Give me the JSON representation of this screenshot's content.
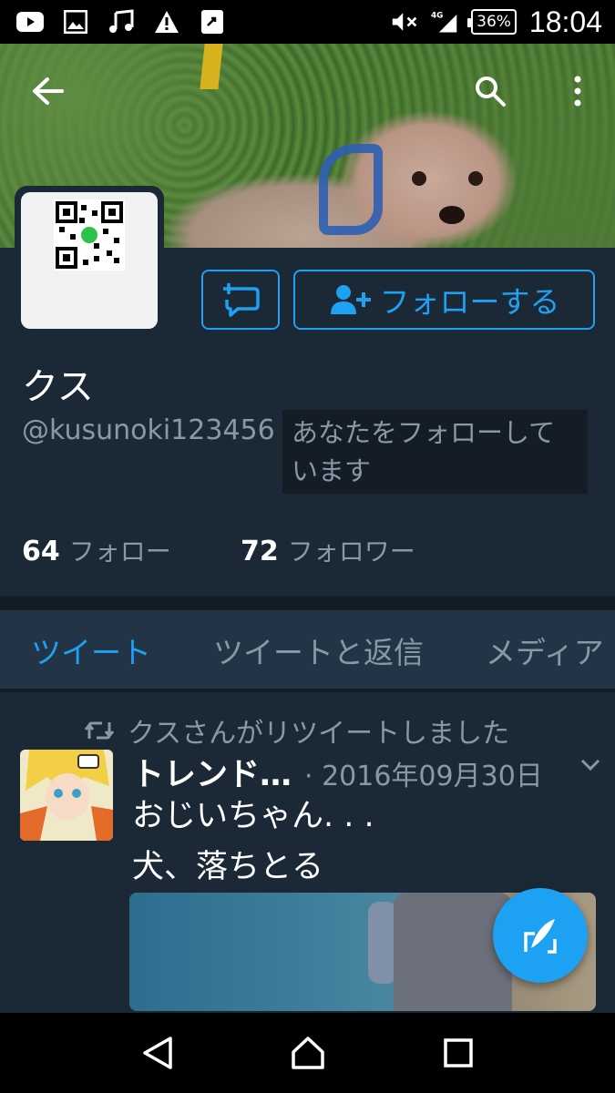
{
  "status_bar": {
    "battery": "36%",
    "network": "4G",
    "time": "18:04",
    "icons": [
      "youtube-icon",
      "image-icon",
      "music-icon",
      "warning-icon",
      "cast-icon",
      "mute-icon",
      "signal-icon",
      "battery-icon"
    ]
  },
  "header": {
    "back_icon": "back-arrow-icon",
    "search_icon": "search-icon",
    "more_icon": "more-vert-icon"
  },
  "profile": {
    "name": "クス",
    "handle": "@kusunoki123456",
    "follows_you": "あなたをフォローしています",
    "following_count": "64",
    "following_label": "フォロー",
    "followers_count": "72",
    "followers_label": "フォロワー",
    "follow_button": "フォローする"
  },
  "tabs": [
    "ツイート",
    "ツイートと返信",
    "メディア"
  ],
  "tweet": {
    "retweet_label": "クスさんがリツイートしました",
    "author": "トレンド…",
    "date": "· 2016年09月30日",
    "text_line1": "おじいちゃん. . .",
    "text_line2": "犬、落ちとる"
  },
  "colors": {
    "accent": "#1da1f2",
    "background": "#1b2836",
    "tab_bar": "#243447",
    "secondary_text": "#8899a6"
  }
}
